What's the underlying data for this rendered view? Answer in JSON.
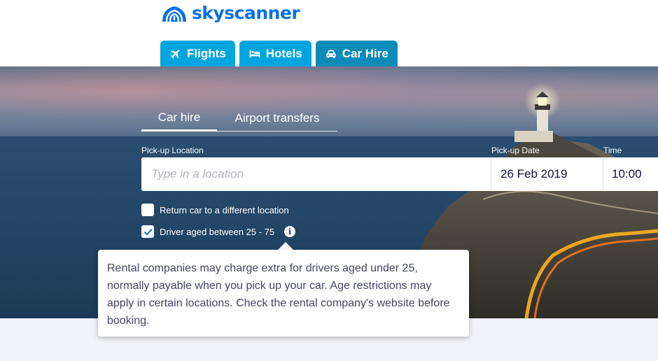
{
  "brand": {
    "name": "skyscanner",
    "color": "#0770e3",
    "icon": "skyscanner-sunrise-logo"
  },
  "main_tabs": [
    {
      "label": "Flights",
      "icon": "plane-icon",
      "active": false
    },
    {
      "label": "Hotels",
      "icon": "bed-icon",
      "active": false
    },
    {
      "label": "Car Hire",
      "icon": "car-icon",
      "active": true
    }
  ],
  "search": {
    "subtabs": [
      {
        "label": "Car hire",
        "active": true
      },
      {
        "label": "Airport transfers",
        "active": false
      }
    ],
    "pickup_location_label": "Pick-up Location",
    "pickup_location_placeholder": "Type in a location",
    "pickup_location_value": "",
    "pickup_date_label": "Pick-up Date",
    "pickup_date_value": "26 Feb 2019",
    "time_label": "Time",
    "time_value": "10:00",
    "return_different_label": "Return car to a different location",
    "return_different_checked": false,
    "driver_age_label": "Driver aged between 25 - 75",
    "driver_age_checked": true
  },
  "tooltip": {
    "text": "Rental companies may charge extra for drivers aged under 25, normally payable when you pick up your car. Age restrictions may apply in certain locations. Check the rental company's website before booking."
  },
  "colors": {
    "tab": "#00a5df",
    "tab_active": "#0a8bb8",
    "check": "#0770e3"
  }
}
